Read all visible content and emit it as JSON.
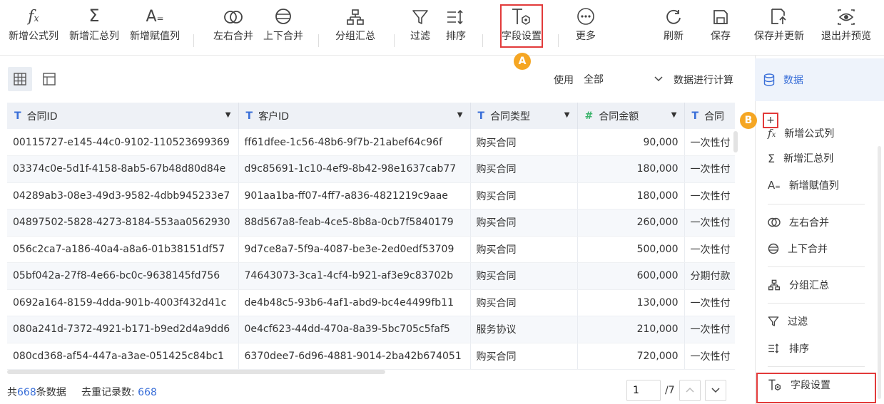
{
  "toolbar": {
    "add_formula": "新增公式列",
    "add_summary": "新增汇总列",
    "add_assign": "新增赋值列",
    "merge_lr": "左右合并",
    "merge_tb": "上下合并",
    "group": "分组汇总",
    "filter": "过滤",
    "sort": "排序",
    "field_settings": "字段设置",
    "more": "更多",
    "refresh": "刷新",
    "save": "保存",
    "save_update": "保存并更新",
    "exit_preview": "退出并预览"
  },
  "badges": {
    "a": "A",
    "b": "B"
  },
  "controls": {
    "use_label": "使用",
    "use_value": "全部",
    "calc_label": "数据进行计算"
  },
  "table": {
    "columns": [
      "合同ID",
      "客户ID",
      "合同类型",
      "合同金额",
      "合同"
    ],
    "rows": [
      [
        "00115727-e145-44c0-9102-110523699369",
        "ff61dfee-1c56-48b6-9f7b-21abef64c96f",
        "购买合同",
        "90,000",
        "一次性付"
      ],
      [
        "03374c0e-5d1f-4158-8ab5-67b48d80d84e",
        "d9c85691-1c10-4ef9-8b42-98e1637cab77",
        "购买合同",
        "180,000",
        "一次性付"
      ],
      [
        "04289ab3-08e3-49d3-9582-4dbb945233e7",
        "901aa1ba-ff07-4ff7-a836-4821219c9aae",
        "购买合同",
        "180,000",
        "一次性付"
      ],
      [
        "04897502-5828-4273-8184-553aa0562930",
        "88d567a8-feab-4ce5-8b8a-0cb7f5840179",
        "购买合同",
        "260,000",
        "一次性付"
      ],
      [
        "056c2ca7-a186-40a4-a8a6-01b38151df57",
        "9d7ce8a7-5f9a-4087-be3e-2ed0edf53709",
        "购买合同",
        "500,000",
        "一次性付"
      ],
      [
        "05bf042a-27f8-4e66-bc0c-9638145fd756",
        "74643073-3ca1-4cf4-b921-af3e9c83702b",
        "购买合同",
        "600,000",
        "分期付款"
      ],
      [
        "0692a164-8159-4dda-901b-4003f432d41c",
        "de4b48c5-93b6-4af1-abd9-bc4e4499fb11",
        "购买合同",
        "130,000",
        "一次性付"
      ],
      [
        "080a241d-7372-4921-b171-b9ed2d4a9dd6",
        "0e4cf623-44dd-470a-8a39-5bc705c5faf5",
        "服务协议",
        "210,000",
        "一次性付"
      ],
      [
        "080cd368-af54-447a-a3ae-051425c84bc1",
        "6370dee7-6d96-4881-9014-2ba42b674051",
        "购买合同",
        "720,000",
        "一次性付"
      ]
    ]
  },
  "footer": {
    "total_prefix": "共",
    "total_count": "668",
    "total_suffix": "条数据",
    "dedup_label": "去重记录数:",
    "dedup_count": "668",
    "page_value": "1",
    "page_total": "/7"
  },
  "side": {
    "title": "数据",
    "plus": "+",
    "items": [
      "新增公式列",
      "新增汇总列",
      "新增赋值列",
      "左右合并",
      "上下合并",
      "分组汇总",
      "过滤",
      "排序",
      "字段设置"
    ]
  },
  "colors": {
    "accent": "#3a6fd8",
    "highlight": "#e23a3a",
    "badge": "#f5a623"
  }
}
